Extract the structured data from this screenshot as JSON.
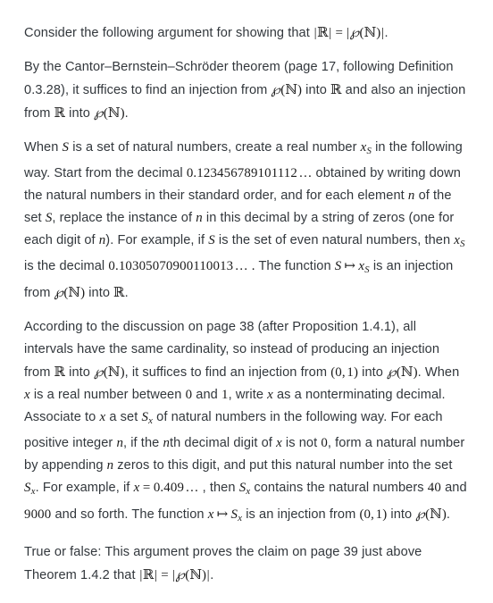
{
  "document": {
    "type": "textbook-exercise",
    "background_color": "#ffffff",
    "text_color": "#32373c",
    "math_color": "#1b1b1b",
    "paragraphs": [
      {
        "id": "p1-claim",
        "name": "paragraph-claim",
        "text": "Consider the following argument for showing that |R| = |P(N)|.",
        "segments": [
          {
            "kind": "text",
            "value": "Consider the following argument for showing that "
          },
          {
            "kind": "math",
            "value": "|ℝ| = |℘(ℕ)|"
          },
          {
            "kind": "text",
            "value": "."
          }
        ]
      },
      {
        "id": "p2-cbs",
        "name": "paragraph-cantor-bernstein-schroeder",
        "text": "By the Cantor–Bernstein–Schröder theorem (page 17, following Definition 0.3.28), it suffices to find an injection from P(N) into R and also an injection from R into P(N).",
        "segments": [
          {
            "kind": "text",
            "value": "By the Cantor–Bernstein–Schröder theorem (page 17, following Definition 0.3.28), it suffices to find an injection from "
          },
          {
            "kind": "math",
            "value": "℘(ℕ)"
          },
          {
            "kind": "text",
            "value": " into "
          },
          {
            "kind": "math",
            "value": "ℝ"
          },
          {
            "kind": "text",
            "value": " and also an injection from "
          },
          {
            "kind": "math",
            "value": "ℝ"
          },
          {
            "kind": "text",
            "value": " into "
          },
          {
            "kind": "math",
            "value": "℘(ℕ)"
          },
          {
            "kind": "text",
            "value": "."
          }
        ],
        "references": {
          "page": "17",
          "definition": "0.3.28",
          "theorem_name": "Cantor–Bernstein–Schröder"
        }
      },
      {
        "id": "p3-injection-forward",
        "name": "paragraph-injection-powerset-to-reals",
        "text": "When S is a set of natural numbers, create a real number x_S in the following way. Start from the decimal 0.123456789101112... obtained by writing down the natural numbers in their standard order, and for each element n of the set S, replace the instance of n in this decimal by a string of zeros (one for each digit of n). For example, if S is the set of even natural numbers, then x_S is the decimal 0.10305070900110013.... The function S ↦ x_S is an injection from P(N) into R.",
        "decimal_seed": "0.123456789101112 …",
        "decimal_example": "0.10305070900110013 … ."
      },
      {
        "id": "p4-injection-backward",
        "name": "paragraph-injection-interval-to-powerset",
        "text": "According to the discussion on page 38 (after Proposition 1.4.1), all intervals have the same cardinality, so instead of producing an injection from R into P(N), it suffices to find an injection from (0,1) into P(N). When x is a real number between 0 and 1, write x as a nonterminating decimal. Associate to x a set S_x of natural numbers in the following way. For each positive integer n, if the nth decimal digit of x is not 0, form a natural number by appending n zeros to this digit, and put this natural number into the set S_x. For example, if x = 0.409..., then S_x contains the natural numbers 40 and 9000 and so forth. The function x ↦ S_x is an injection from (0,1) into P(N).",
        "references": {
          "page": "38",
          "proposition": "1.4.1"
        },
        "example_value": "0.409 …",
        "example_members": [
          "40",
          "9000"
        ]
      },
      {
        "id": "p5-question",
        "name": "paragraph-true-false-question",
        "text": "True or false: This argument proves the claim on page 39 just above Theorem 1.4.2 that |R| = |P(N)|.",
        "prompt": "True or false:",
        "references": {
          "page": "39",
          "theorem": "1.4.2"
        }
      }
    ],
    "math_symbols": {
      "reals": "ℝ",
      "naturals": "ℕ",
      "powerset": "℘",
      "mapsto": "↦",
      "ellipsis": "…"
    },
    "labels": {
      "set_S": "S",
      "real_xS": "x_S",
      "set_Sx": "S_x",
      "variable_x": "x",
      "variable_n": "n",
      "interval": "(0, 1)"
    }
  }
}
